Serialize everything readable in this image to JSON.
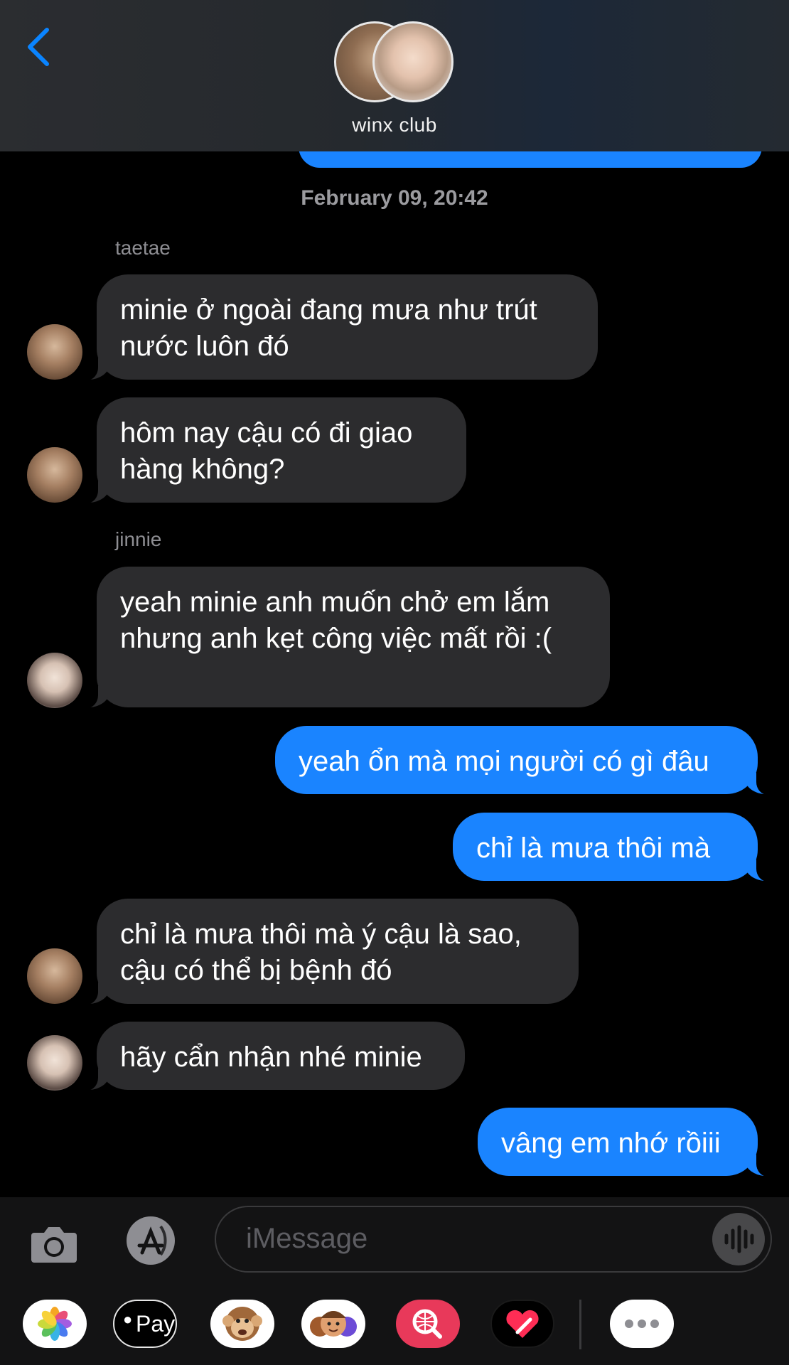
{
  "header": {
    "group_name": "winx club"
  },
  "timestamp": "February 09, 20:42",
  "senders": {
    "taetae": "taetae",
    "jinnie": "jinnie"
  },
  "messages": [
    {
      "from": "taetae",
      "text": "minie ở ngoài đang mưa như trút nước luôn đó"
    },
    {
      "from": "taetae",
      "text": "hôm nay cậu có đi giao hàng không?"
    },
    {
      "from": "jinnie",
      "text": "yeah minie anh muốn chở em lắm nhưng anh kẹt công việc mất rồi :("
    },
    {
      "from": "me",
      "text": "yeah ổn mà mọi người có gì đâu"
    },
    {
      "from": "me",
      "text": "chỉ là mưa thôi mà"
    },
    {
      "from": "taetae",
      "text": "chỉ là mưa thôi mà ý cậu là sao, cậu có thể bị bệnh đó"
    },
    {
      "from": "jinnie",
      "text": "hãy cẩn nhận nhé minie"
    },
    {
      "from": "me",
      "text": "vâng em nhớ rồiii"
    }
  ],
  "input": {
    "placeholder": "iMessage"
  },
  "app_drawer": [
    "photos-app",
    "apple-pay-app",
    "animoji-app",
    "memoji-app",
    "web-search-app",
    "digital-touch-app",
    "more-apps"
  ],
  "apple_pay_label": "Pay",
  "colors": {
    "outgoing": "#1a84ff",
    "incoming": "#2c2c2e",
    "accent": "#0a84ff"
  }
}
